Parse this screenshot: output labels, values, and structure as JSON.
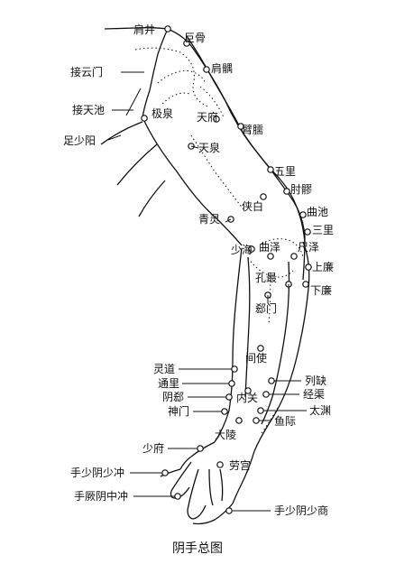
{
  "caption": "阴手总图",
  "points": {
    "jianjing": "肩井",
    "jugu": "巨骨",
    "jianyu": "肩髃",
    "jieyunmen": "接云门",
    "jietianchi": "接天池",
    "jiquan": "极泉",
    "tianfu": "天府",
    "binao": "臂臑",
    "zushaoyang": "足少阳",
    "tianquan": "天泉",
    "wuli": "五里",
    "zhouliao": "肘髎",
    "xiabai": "侠白",
    "quchi": "曲池",
    "qingling": "青灵",
    "sanli": "三里",
    "shaohai": "少海",
    "quze": "曲泽",
    "chize": "尺泽",
    "shanglian": "上廉",
    "kongzui": "孔最",
    "xialian": "下廉",
    "ximen": "郄门",
    "jianshi": "间使",
    "lingdao": "灵道",
    "lieque": "列缺",
    "tongli": "通里",
    "jingqu": "经渠",
    "neiguan": "内关",
    "yinxi": "阴郄",
    "shenmen": "神门",
    "taiyuan": "太渊",
    "yuji": "鱼际",
    "daling": "大陵",
    "shaofu": "少府",
    "laogong": "劳宫",
    "shaochong": "手少阴少冲",
    "zhongchong": "手厥阴中冲",
    "shaoshang": "手少阴少商"
  }
}
